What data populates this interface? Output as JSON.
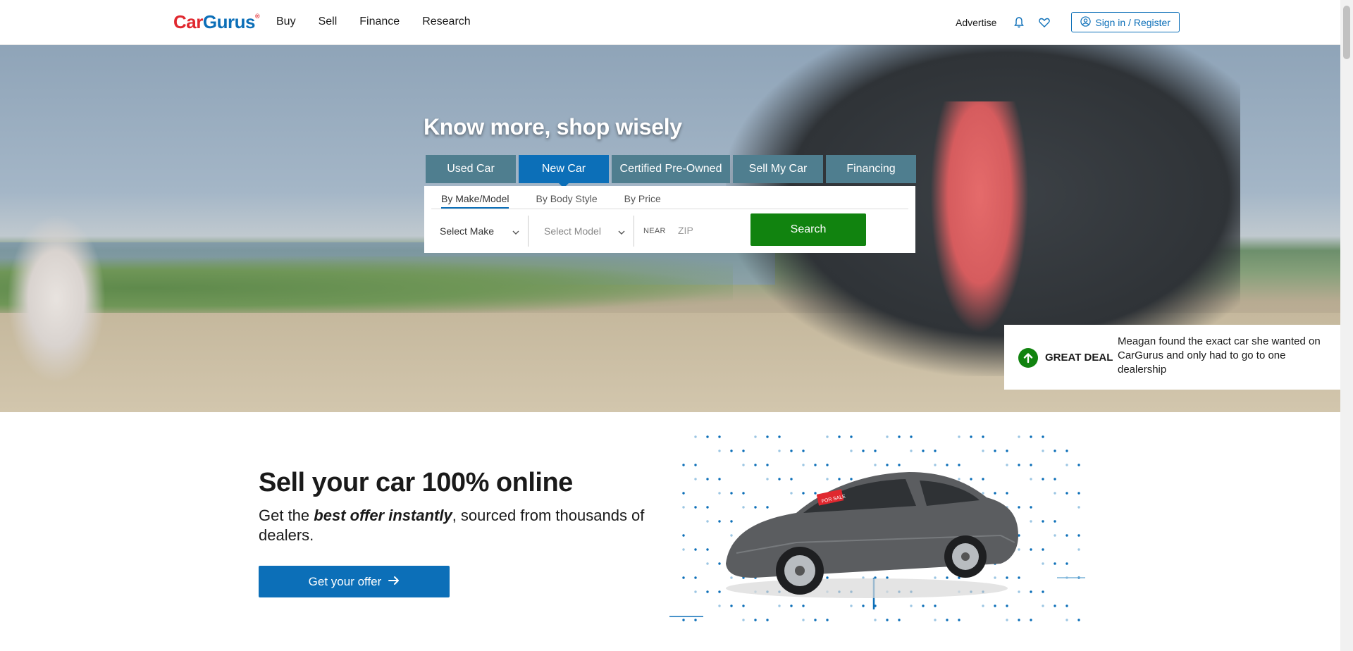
{
  "header": {
    "logo_car": "Car",
    "logo_gurus": "Gurus",
    "logo_reg": "®",
    "nav": [
      "Buy",
      "Sell",
      "Finance",
      "Research"
    ],
    "advertise": "Advertise",
    "signin": "Sign in / Register",
    "icons": [
      "bell-icon",
      "heart-icon",
      "user-circle-icon"
    ]
  },
  "hero": {
    "title": "Know more, shop wisely",
    "tabs": [
      "Used Car",
      "New Car",
      "Certified Pre-Owned",
      "Sell My Car",
      "Financing"
    ],
    "active_tab": "New Car",
    "subtabs": [
      "By Make/Model",
      "By Body Style",
      "By Price"
    ],
    "active_subtab": "By Make/Model",
    "make_select": "Select Make",
    "model_select": "Select Model",
    "near_label": "NEAR",
    "zip_placeholder": "ZIP",
    "search_button": "Search",
    "deal": {
      "label": "GREAT DEAL",
      "text": "Meagan found the exact car she wanted on CarGurus and only had to go to one dealership"
    }
  },
  "sell": {
    "title": "Sell your car 100% online",
    "sub_before": "Get the ",
    "sub_em": "best offer instantly",
    "sub_after": ", sourced from thousands of dealers.",
    "button": "Get your offer",
    "sticker": "FOR SALE"
  },
  "colors": {
    "brand_blue": "#0c6fb8",
    "brand_red": "#e0282f",
    "search_green": "#11830f",
    "tab_teal": "#4f7e8f"
  }
}
